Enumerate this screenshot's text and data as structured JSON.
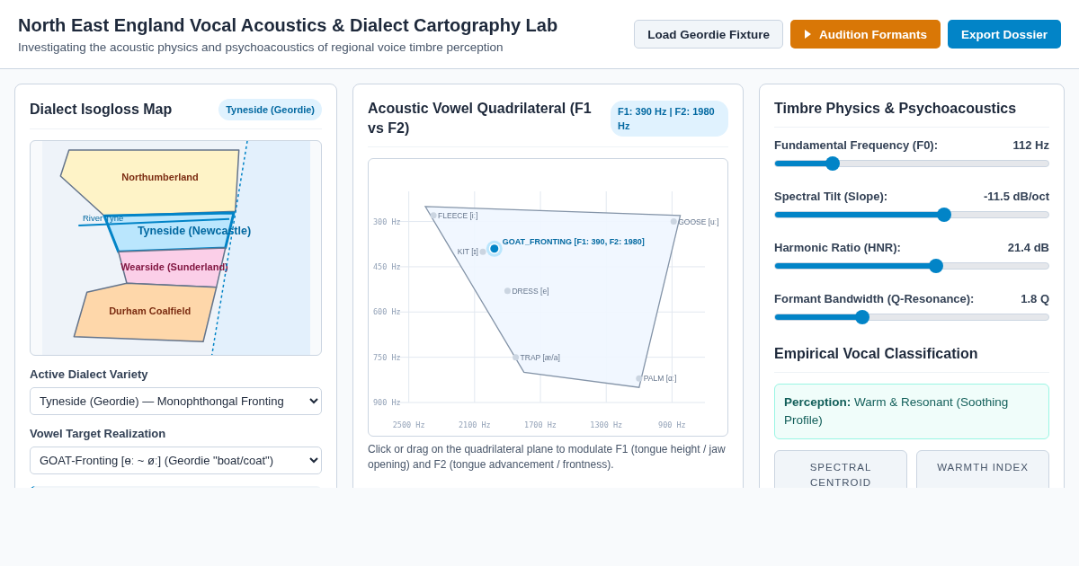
{
  "header": {
    "title": "North East England Vocal Acoustics & Dialect Cartography Lab",
    "subtitle": "Investigating the acoustic physics and psychoacoustics of regional voice timbre perception",
    "buttons": [
      {
        "label": "Load Geordie Fixture",
        "kind": "secondary"
      },
      {
        "label": "Audition Formants",
        "kind": "play"
      },
      {
        "label": "Export Dossier",
        "kind": "primary"
      }
    ]
  },
  "map_panel": {
    "title": "Dialect Isogloss Map",
    "badge": "Tyneside (Geordie)",
    "regions": [
      {
        "name": "Northumberland",
        "color": "#fef3c7",
        "selected": false
      },
      {
        "name": "Tyneside (Newcastle)",
        "color": "#bae6fd",
        "selected": true
      },
      {
        "name": "Wearside (Sunderland)",
        "color": "#fbcfe8",
        "selected": false
      },
      {
        "name": "Durham Coalfield",
        "color": "#fed7aa",
        "selected": false
      }
    ],
    "river_label": "River Tyne",
    "fields": [
      {
        "label": "Active Dialect Variety",
        "value": "Tyneside (Geordie) — Monophthongal Fronting"
      },
      {
        "label": "Vowel Target Realization",
        "value": "GOAT-Fronting [ɵː ~ øː] (Geordie \"boat/coat\")"
      }
    ]
  },
  "vowel_panel": {
    "title": "Acoustic Vowel Quadrilateral (F1 vs F2)",
    "badge": "F1: 390 Hz | F2: 1980 Hz",
    "chart_data": {
      "type": "scatter",
      "xlim": [
        2580,
        700
      ],
      "ylim": [
        900,
        200
      ],
      "grid": true,
      "xticks": [
        {
          "value": 2500,
          "label": "2500 Hz"
        },
        {
          "value": 2100,
          "label": "2100 Hz"
        },
        {
          "value": 1700,
          "label": "1700 Hz"
        },
        {
          "value": 1300,
          "label": "1300 Hz"
        },
        {
          "value": 900,
          "label": "900 Hz"
        }
      ],
      "yticks": [
        {
          "value": 300,
          "label": "300 Hz"
        },
        {
          "value": 450,
          "label": "450 Hz"
        },
        {
          "value": 600,
          "label": "600 Hz"
        },
        {
          "value": 750,
          "label": "750 Hz"
        },
        {
          "value": 900,
          "label": "900 Hz"
        }
      ],
      "series": [
        {
          "color": "#cbd5e1",
          "x": [
            2350,
            2050,
            1900,
            1850,
            1100,
            890
          ],
          "values": [
            280,
            400,
            530,
            750,
            820,
            300
          ]
        },
        {
          "color": "#0284c7",
          "x": [
            1980
          ],
          "values": [
            390
          ]
        }
      ],
      "annotations": [
        {
          "x": 2350,
          "y": 280,
          "text": "FLEECE [iː]"
        },
        {
          "x": 2050,
          "y": 400,
          "text": "KIT [ɪ]"
        },
        {
          "x": 1900,
          "y": 530,
          "text": "DRESS [e]"
        },
        {
          "x": 1850,
          "y": 750,
          "text": "TRAP [æ/a]"
        },
        {
          "x": 1100,
          "y": 820,
          "text": "PALM [ɑː]"
        },
        {
          "x": 890,
          "y": 300,
          "text": "GOOSE [uː]"
        },
        {
          "x": 1980,
          "y": 390,
          "text": "GOAT_FRONTING [F1: 390, F2: 1980]"
        }
      ]
    },
    "caption": "Click or drag on the quadrilateral plane to modulate F1 (tongue height / jaw opening) and F2 (tongue advancement / frontness)."
  },
  "timbre_panel": {
    "title": "Timbre Physics & Psychoacoustics",
    "sliders": [
      {
        "label": "Fundamental Frequency (F0):",
        "reading": "112 Hz",
        "level": 0.21
      },
      {
        "label": "Spectral Tilt (Slope):",
        "reading": "-11.5 dB/oct",
        "level": 0.62
      },
      {
        "label": "Harmonic Ratio (HNR):",
        "reading": "21.4 dB",
        "level": 0.59
      },
      {
        "label": "Formant Bandwidth (Q-Resonance):",
        "reading": "1.8 Q",
        "level": 0.32
      }
    ]
  },
  "classification": {
    "title": "Empirical Vocal Classification",
    "perception": "**Perception:** Warm & Resonant (Soothing Profile)",
    "metrics": [
      {
        "label": "SPECTRAL CENTROID"
      },
      {
        "label": "WARMTH INDEX"
      }
    ]
  }
}
